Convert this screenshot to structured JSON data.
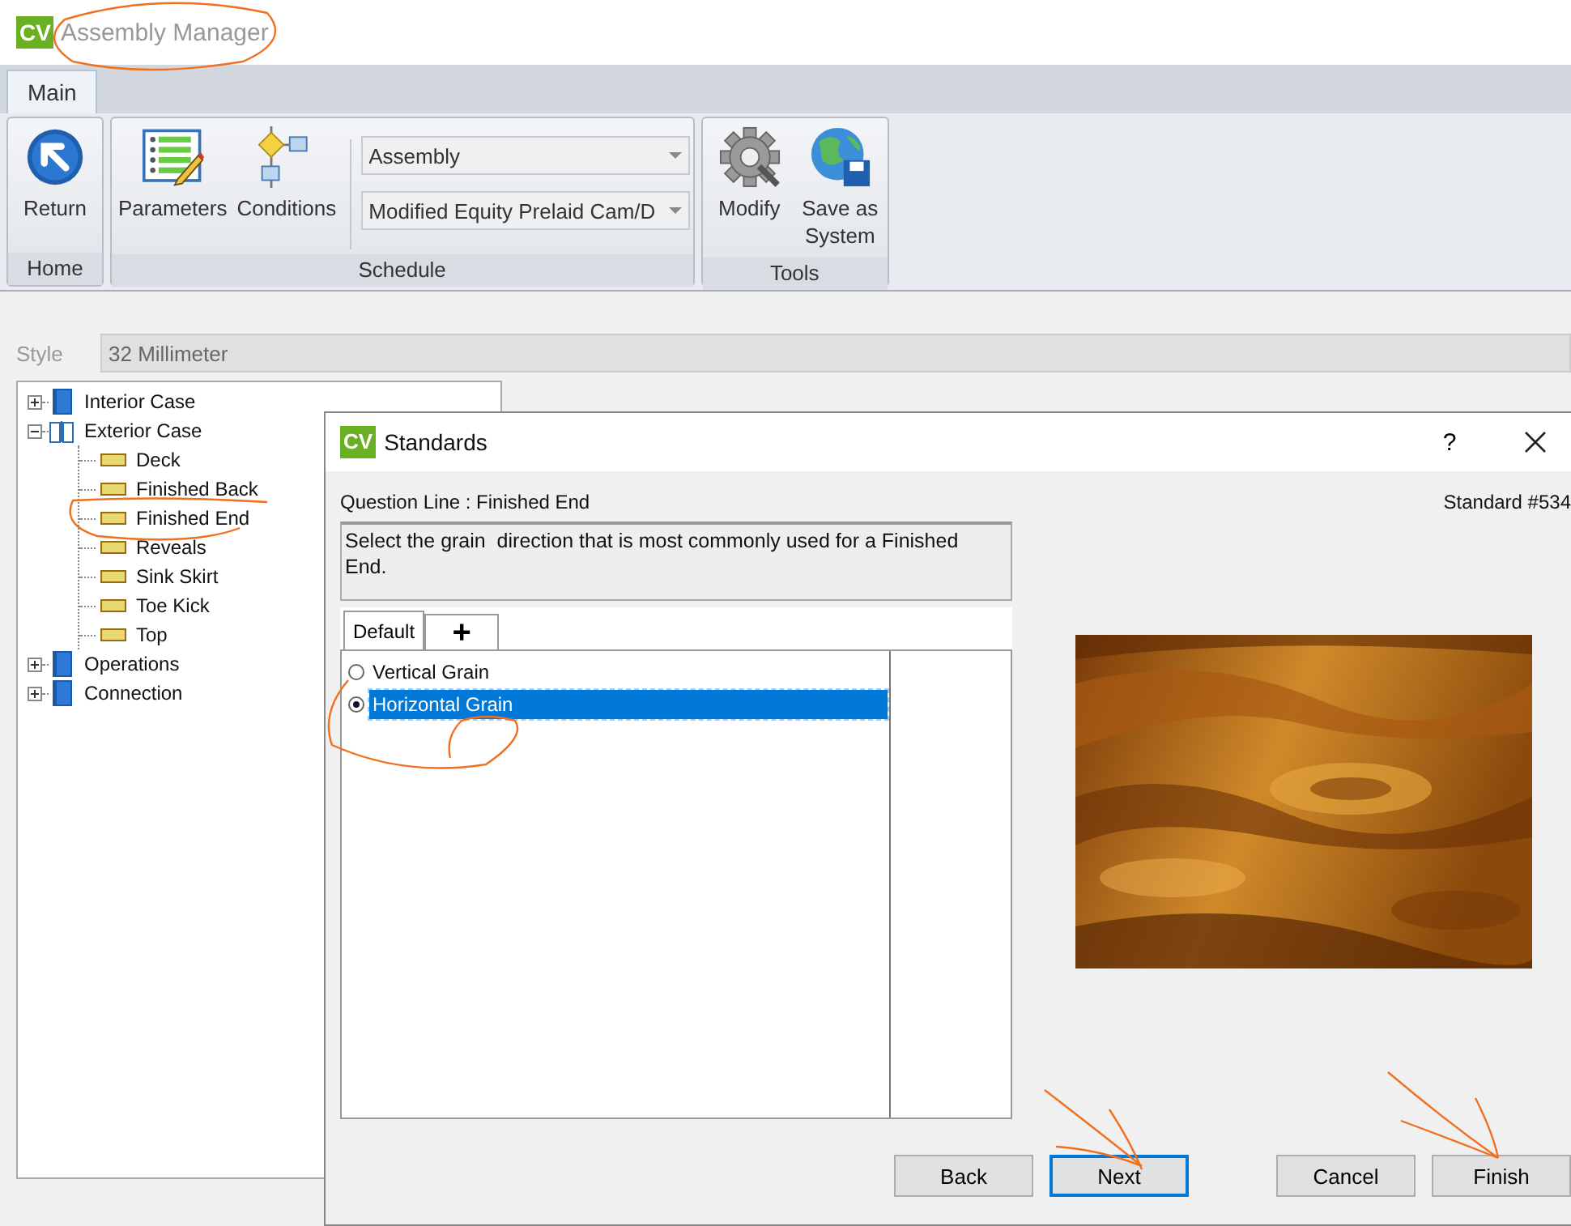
{
  "window": {
    "logo": "CV",
    "title": "Assembly Manager"
  },
  "tabs": [
    {
      "label": "Main",
      "selected": true
    }
  ],
  "ribbon": {
    "groups": [
      {
        "label": "Home",
        "items": [
          {
            "kind": "large-button",
            "label": "Return"
          }
        ]
      },
      {
        "label": "Schedule",
        "items": [
          {
            "kind": "large-button",
            "label": "Parameters"
          },
          {
            "kind": "large-button",
            "label": "Conditions"
          },
          {
            "kind": "dropdowns",
            "values": [
              "Assembly",
              "Modified Equity Prelaid Cam/D"
            ]
          }
        ]
      },
      {
        "label": "Tools",
        "items": [
          {
            "kind": "large-button",
            "label": "Modify"
          },
          {
            "kind": "large-button",
            "label": "Save as System"
          }
        ]
      }
    ]
  },
  "style_field": {
    "label": "Style",
    "value": "32 Millimeter"
  },
  "tree": [
    {
      "label": "Interior Case",
      "expanded": false
    },
    {
      "label": "Exterior Case",
      "expanded": true,
      "children": [
        {
          "label": "Deck"
        },
        {
          "label": "Finished Back"
        },
        {
          "label": "Finished End"
        },
        {
          "label": "Reveals"
        },
        {
          "label": "Sink Skirt"
        },
        {
          "label": "Toe Kick"
        },
        {
          "label": "Top"
        }
      ]
    },
    {
      "label": "Operations",
      "expanded": false
    },
    {
      "label": "Connection",
      "expanded": false
    }
  ],
  "dialog": {
    "logo": "CV",
    "title": "Standards",
    "help": "?",
    "question_line": "Question Line : Finished End",
    "standard": "Standard #534",
    "description": "Select the grain  direction that is most commonly used for a Finished End.",
    "tabs": [
      {
        "label": "Default",
        "selected": true
      },
      {
        "label": "+",
        "selected": false
      }
    ],
    "options": [
      {
        "label": "Vertical Grain",
        "selected": false
      },
      {
        "label": "Horizontal Grain",
        "selected": true
      }
    ],
    "buttons": [
      {
        "label": "Back",
        "default": false
      },
      {
        "label": "Next",
        "default": true
      },
      {
        "label": "Cancel",
        "default": false
      },
      {
        "label": "Finish",
        "default": false
      }
    ]
  }
}
